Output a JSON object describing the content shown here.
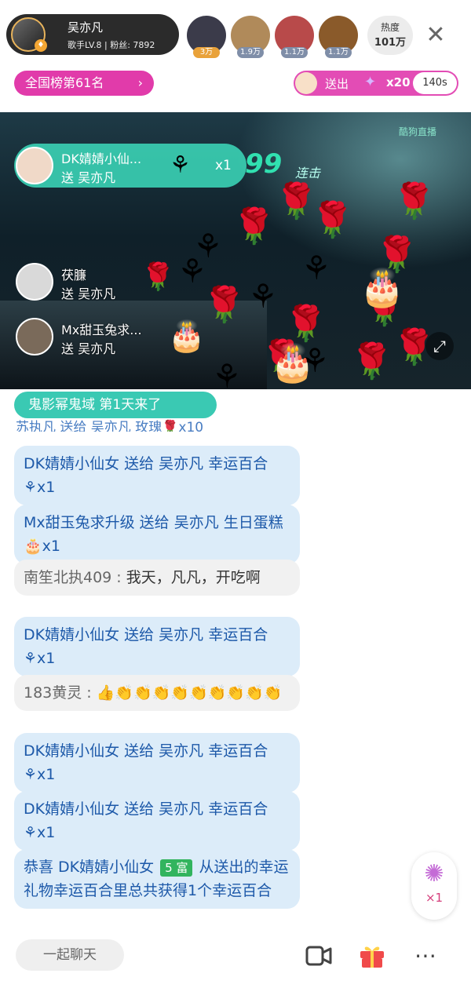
{
  "host": {
    "name": "吴亦凡",
    "info": "歌手LV.8 | 粉丝: 7892"
  },
  "viewers": [
    {
      "count": "3万",
      "color": "#e9a23a",
      "bg": "#3b3b4a"
    },
    {
      "count": "1.9万",
      "color": "#7f8ea8",
      "bg": "#b08a5a"
    },
    {
      "count": "1.1万",
      "color": "#7f8ea8",
      "bg": "#b84a4a"
    },
    {
      "count": "1.1万",
      "color": "#7f8ea8",
      "bg": "#8a5a2a"
    }
  ],
  "heat": {
    "label": "热度",
    "value": "101万"
  },
  "rank": {
    "label": "全国榜第61名"
  },
  "sent": {
    "label": "送出",
    "count": "x20",
    "timer": "140s"
  },
  "gift_notes": [
    {
      "name": "DK婧婧小仙...",
      "action": "送 吴亦凡",
      "count": "x1"
    },
    {
      "name": "茯臁",
      "action": "送 吴亦凡"
    },
    {
      "name": "Mx甜玉兔求...",
      "action": "送 吴亦凡"
    }
  ],
  "video": {
    "combo": "99",
    "combo_sub": "连击",
    "watermark": "酷狗直播"
  },
  "enter_banner": "鬼影幂鬼域 第1天来了",
  "chat_partial": "苏执凡 送给 吴亦凡 玫瑰🌹x10",
  "messages": [
    {
      "kind": "gift",
      "text": "DK婧婧小仙女 送给 吴亦凡 幸运百合",
      "suffix": "x1"
    },
    {
      "kind": "gift",
      "text": "Mx甜玉兔求升级 送给 吴亦凡 生日蛋糕",
      "suffix": "x1"
    },
    {
      "kind": "user",
      "user": "南笙北执409 : ",
      "text": "我天，凡凡，开吃啊"
    },
    {
      "kind": "gift",
      "text": "DK婧婧小仙女 送给 吴亦凡 幸运百合",
      "suffix": "x1"
    },
    {
      "kind": "user",
      "user": "183黄灵 : ",
      "text": "👍👏👏👏👏👏👏👏👏👏"
    },
    {
      "kind": "gift",
      "text": "DK婧婧小仙女 送给 吴亦凡 幸运百合",
      "suffix": "x1"
    },
    {
      "kind": "gift",
      "text": "DK婧婧小仙女 送给 吴亦凡 幸运百合",
      "suffix": "x1"
    },
    {
      "kind": "system",
      "pre": "恭喜 DK婧婧小仙女 ",
      "badge": "5 富",
      "post": " 从送出的幸运礼物幸运百合里总共获得1个幸运百合"
    }
  ],
  "gift_button": {
    "count": "×1"
  },
  "bottom": {
    "chat_placeholder": "一起聊天"
  }
}
